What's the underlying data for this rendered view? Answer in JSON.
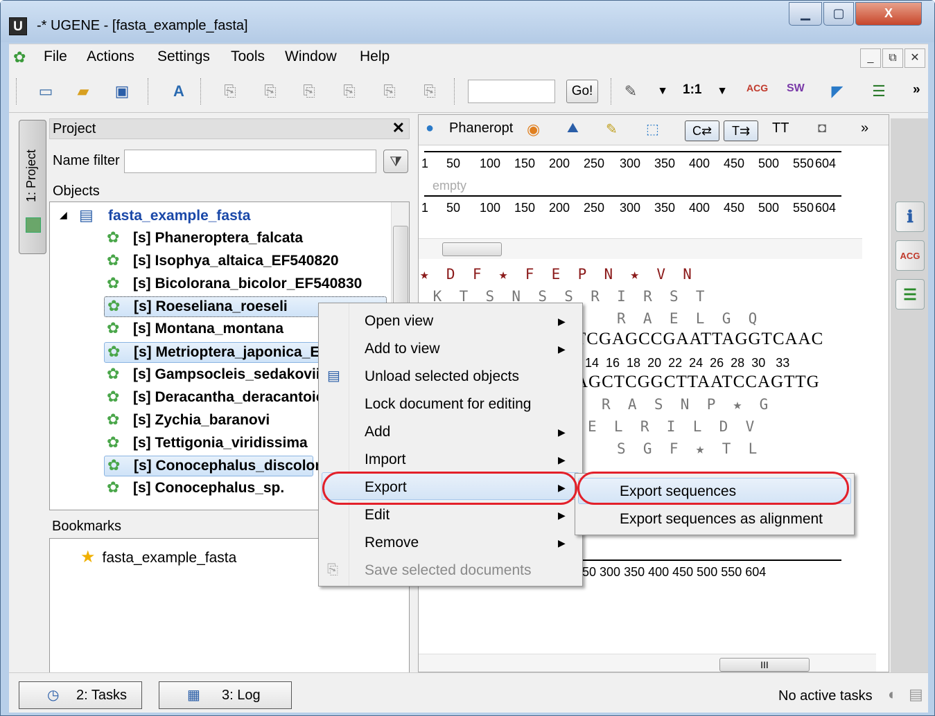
{
  "window": {
    "app_badge": "U",
    "title": "-* UGENE - [fasta_example_fasta]",
    "minimize": "▁",
    "maximize": "▢",
    "close": "X"
  },
  "menu": {
    "items": [
      "File",
      "Actions",
      "Settings",
      "Tools",
      "Window",
      "Help"
    ],
    "mdi_min": "_",
    "mdi_restore": "⧉",
    "mdi_close": "✕"
  },
  "toolbar": {
    "search_value": "",
    "go_label": "Go!",
    "zoom_label": "1:1",
    "acg_label": "ACG",
    "sw_label": "SW",
    "more": "»"
  },
  "left_tab": {
    "label": "1: Project"
  },
  "project": {
    "header": "Project",
    "close": "✕",
    "name_filter_label": "Name filter",
    "name_filter_value": "",
    "objects_label": "Objects",
    "root": "fasta_example_fasta",
    "items": [
      "[s] Phaneroptera_falcata",
      "[s] Isophya_altaica_EF540820",
      "[s] Bicolorana_bicolor_EF540830",
      "[s] Roeseliana_roeseli",
      "[s] Montana_montana",
      "[s] Metrioptera_japonica_EI",
      "[s] Gampsocleis_sedakovii_",
      "[s] Deracantha_deracantoic",
      "[s] Zychia_baranovi",
      "[s] Tettigonia_viridissima",
      "[s] Conocephalus_discolor",
      "[s] Conocephalus_sp."
    ],
    "bookmarks_label": "Bookmarks",
    "bookmarks": [
      "fasta_example_fasta"
    ]
  },
  "seq_view": {
    "name": "Phaneropt",
    "c_btn": "C⇄",
    "t_btn": "T⇉",
    "tt_btn": "TT",
    "ruler_ticks": [
      "1",
      "50",
      "100",
      "150",
      "200",
      "250",
      "300",
      "350",
      "400",
      "450",
      "500",
      "550",
      "604"
    ],
    "empty_label": "empty",
    "aa_row1": "★  D  F  ★  F  E  P  N  ★  V  N",
    "aa_row2": " K  T  S  N  S  S  R  I  R  S  T",
    "aa_row3": "R  A  E  L  G  Q",
    "dna_fwd": "TCGAGCCGAATTAGGTCAAC",
    "ruler2": "14  16  18  20  22  24  26  28  30   33",
    "dna_rev": "AGCTCGGCTTAATCCAGTTG",
    "aa_row4": "R  A  S  N  P  ★  G",
    "aa_row5": "E  L  R  I  L  D  V",
    "aa_row6": "S  G  F  ★  T  L",
    "bottom_ruler": "250  300  350  400  450  500  550 604",
    "scroll_label": "III"
  },
  "context_menu": {
    "items": [
      {
        "label": "Open view",
        "submenu": true,
        "disabled": false
      },
      {
        "label": "Add to view",
        "submenu": true,
        "disabled": false
      },
      {
        "label": "Unload selected objects",
        "submenu": false,
        "disabled": false
      },
      {
        "label": "Lock document for editing",
        "submenu": false,
        "disabled": false
      },
      {
        "label": "Add",
        "submenu": true,
        "disabled": false
      },
      {
        "label": "Import",
        "submenu": true,
        "disabled": false
      },
      {
        "label": "Export",
        "submenu": true,
        "disabled": false
      },
      {
        "label": "Edit",
        "submenu": true,
        "disabled": false
      },
      {
        "label": "Remove",
        "submenu": true,
        "disabled": false
      },
      {
        "label": "Save selected documents",
        "submenu": false,
        "disabled": true
      }
    ],
    "arrow": "▶"
  },
  "export_submenu": {
    "items": [
      "Export sequences",
      "Export sequences as alignment"
    ]
  },
  "statusbar": {
    "tasks_label": "2: Tasks",
    "log_label": "3: Log",
    "status": "No active tasks"
  },
  "colors": {
    "highlight_ring": "#e3202a",
    "link_blue": "#1a48a8",
    "sequence_green": "#4aa64a"
  }
}
